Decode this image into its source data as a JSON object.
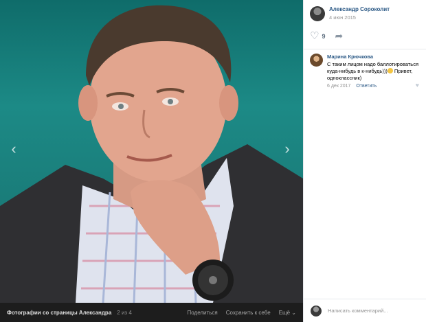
{
  "post": {
    "author": "Александр Сороколит",
    "date": "4 июн 2015",
    "likes": "9"
  },
  "comment": {
    "author": "Марина Крючкова",
    "text": "С таким лицом надо баллотироваться куда-нибудь в к-нибудь)))",
    "text_tail": " Привет, одноклассник)",
    "date": "6 дек 2017",
    "reply_label": "Ответить"
  },
  "composer": {
    "placeholder": "Написать комментарий..."
  },
  "footer": {
    "album": "Фотографии со страницы Александра",
    "counter": "2 из 4",
    "share": "Поделиться",
    "save": "Сохранить к себе",
    "more": "Ещё ⌄"
  },
  "icons": {
    "prev": "chevron-left-icon",
    "next": "chevron-right-icon",
    "like": "heart-icon",
    "share": "share-arrow-icon"
  },
  "colors": {
    "link": "#2a5885",
    "photo_background": "#1a7b78"
  }
}
